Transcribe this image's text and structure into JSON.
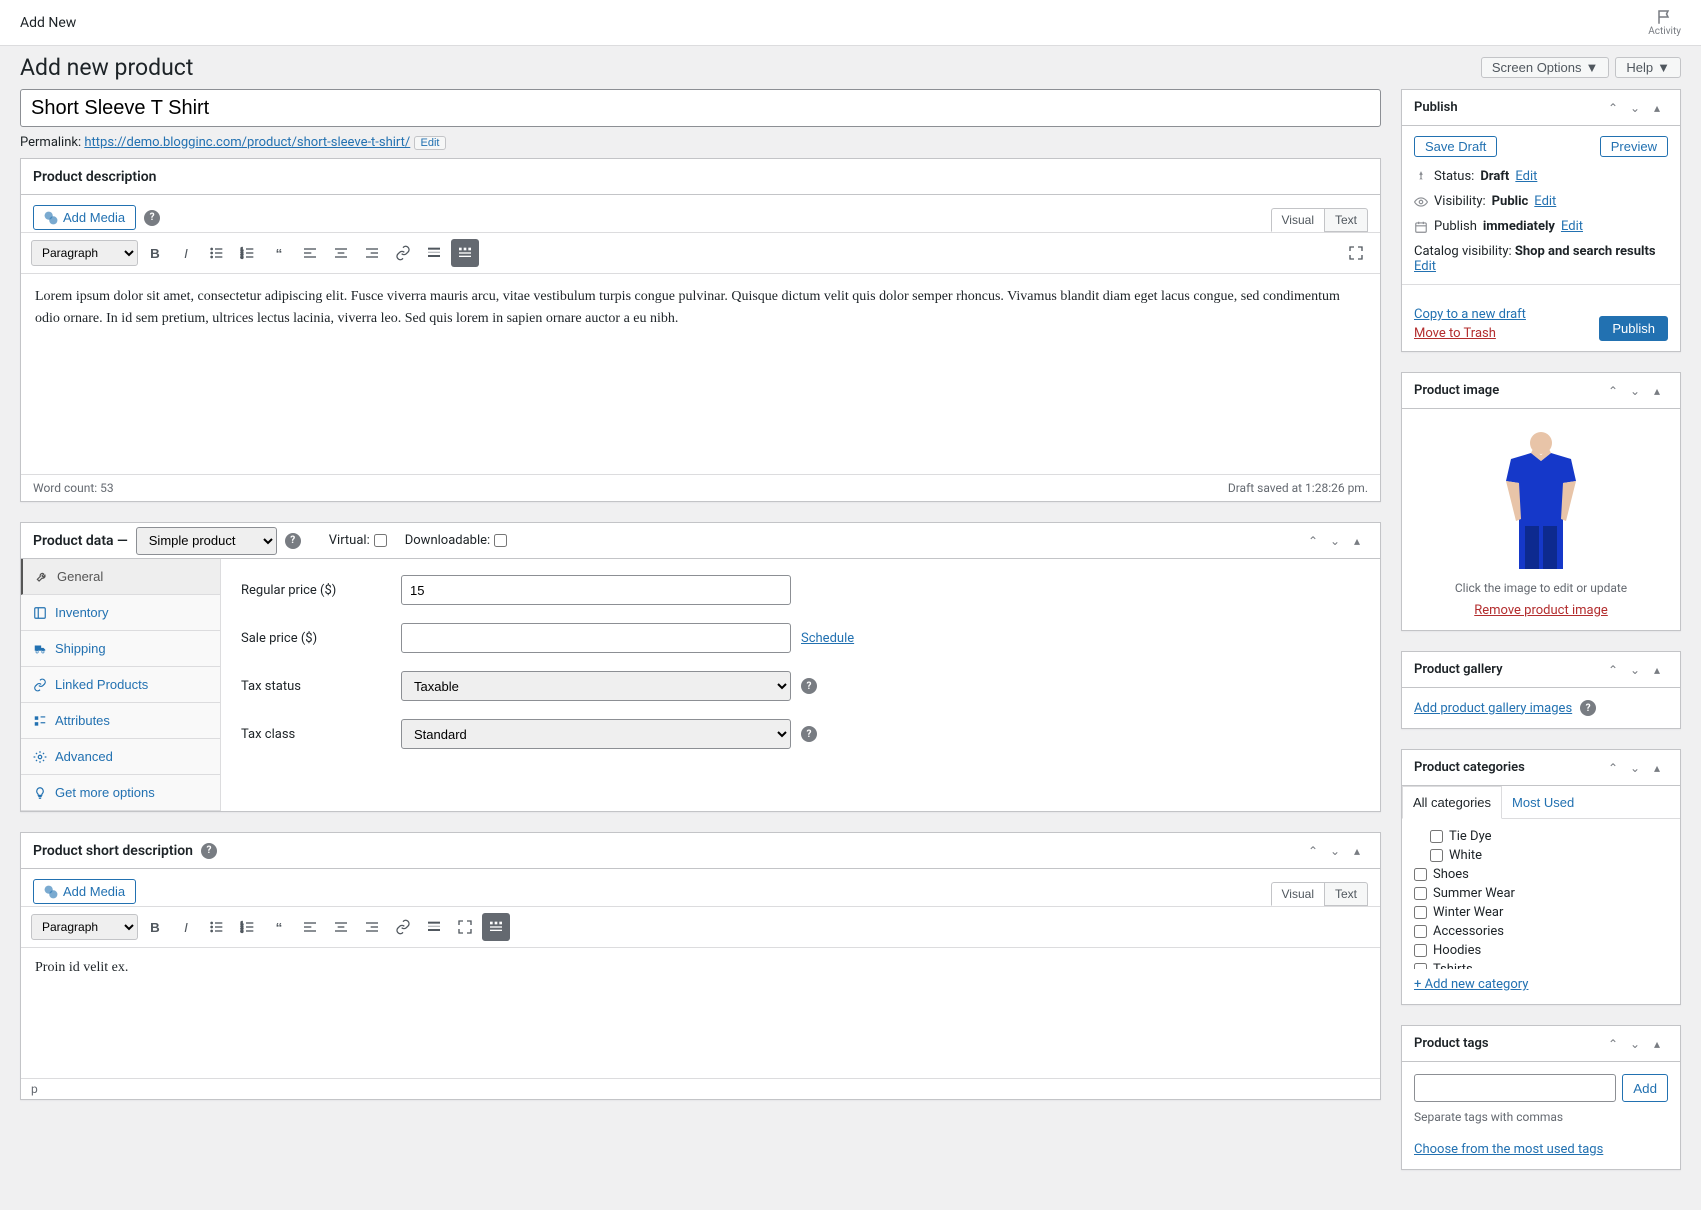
{
  "topbar": {
    "title": "Add New",
    "activity": "Activity"
  },
  "header": {
    "page_title": "Add new product",
    "screen_options": "Screen Options",
    "help": "Help"
  },
  "title_input": "Short Sleeve T Shirt",
  "permalink": {
    "label": "Permalink:",
    "base": "https://demo.blogginc.com/",
    "path": "product/short-sleeve-t-shirt/",
    "edit": "Edit"
  },
  "description": {
    "title": "Product description",
    "add_media": "Add Media",
    "tab_visual": "Visual",
    "tab_text": "Text",
    "format": "Paragraph",
    "body": "Lorem ipsum dolor sit amet, consectetur adipiscing elit. Fusce viverra mauris arcu, vitae vestibulum turpis congue pulvinar. Quisque dictum velit quis dolor semper rhoncus. Vivamus blandit diam eget lacus congue, sed condimentum odio ornare. In id sem pretium, ultrices lectus lacinia, viverra leo. Sed quis lorem in sapien ornare auctor a eu nibh.",
    "word_count": "Word count: 53",
    "draft_saved": "Draft saved at 1:28:26 pm."
  },
  "product_data": {
    "title": "Product data —",
    "type": "Simple product",
    "virtual": "Virtual:",
    "downloadable": "Downloadable:",
    "tabs": {
      "general": "General",
      "inventory": "Inventory",
      "shipping": "Shipping",
      "linked": "Linked Products",
      "attributes": "Attributes",
      "advanced": "Advanced",
      "more": "Get more options"
    },
    "fields": {
      "regular_price_label": "Regular price ($)",
      "regular_price_value": "15",
      "sale_price_label": "Sale price ($)",
      "sale_price_value": "",
      "schedule": "Schedule",
      "tax_status_label": "Tax status",
      "tax_status_value": "Taxable",
      "tax_class_label": "Tax class",
      "tax_class_value": "Standard"
    }
  },
  "short_desc": {
    "title": "Product short description",
    "add_media": "Add Media",
    "tab_visual": "Visual",
    "tab_text": "Text",
    "format": "Paragraph",
    "body_pre": "Proin",
    "body_mid": " id ",
    "body_w2": "velit",
    "body_post": " ex.",
    "path": "p"
  },
  "publish": {
    "title": "Publish",
    "save_draft": "Save Draft",
    "preview": "Preview",
    "status_label": "Status:",
    "status_value": "Draft",
    "status_edit": "Edit",
    "visibility_label": "Visibility:",
    "visibility_value": "Public",
    "visibility_edit": "Edit",
    "publish_label": "Publish",
    "publish_value": "immediately",
    "publish_edit": "Edit",
    "catalog_label": "Catalog visibility:",
    "catalog_value": "Shop and search results",
    "catalog_edit": "Edit",
    "copy_draft": "Copy to a new draft",
    "move_trash": "Move to Trash",
    "publish_btn": "Publish"
  },
  "product_image": {
    "title": "Product image",
    "hint": "Click the image to edit or update",
    "remove": "Remove product image"
  },
  "gallery": {
    "title": "Product gallery",
    "add": "Add product gallery images"
  },
  "categories": {
    "title": "Product categories",
    "tab_all": "All categories",
    "tab_most": "Most Used",
    "items": [
      "Tie Dye",
      "White",
      "Shoes",
      "Summer Wear",
      "Winter Wear",
      "Accessories",
      "Hoodies",
      "Tshirts"
    ],
    "add_new": "+ Add new category"
  },
  "tags": {
    "title": "Product tags",
    "add": "Add",
    "hint": "Separate tags with commas",
    "choose": "Choose from the most used tags"
  }
}
